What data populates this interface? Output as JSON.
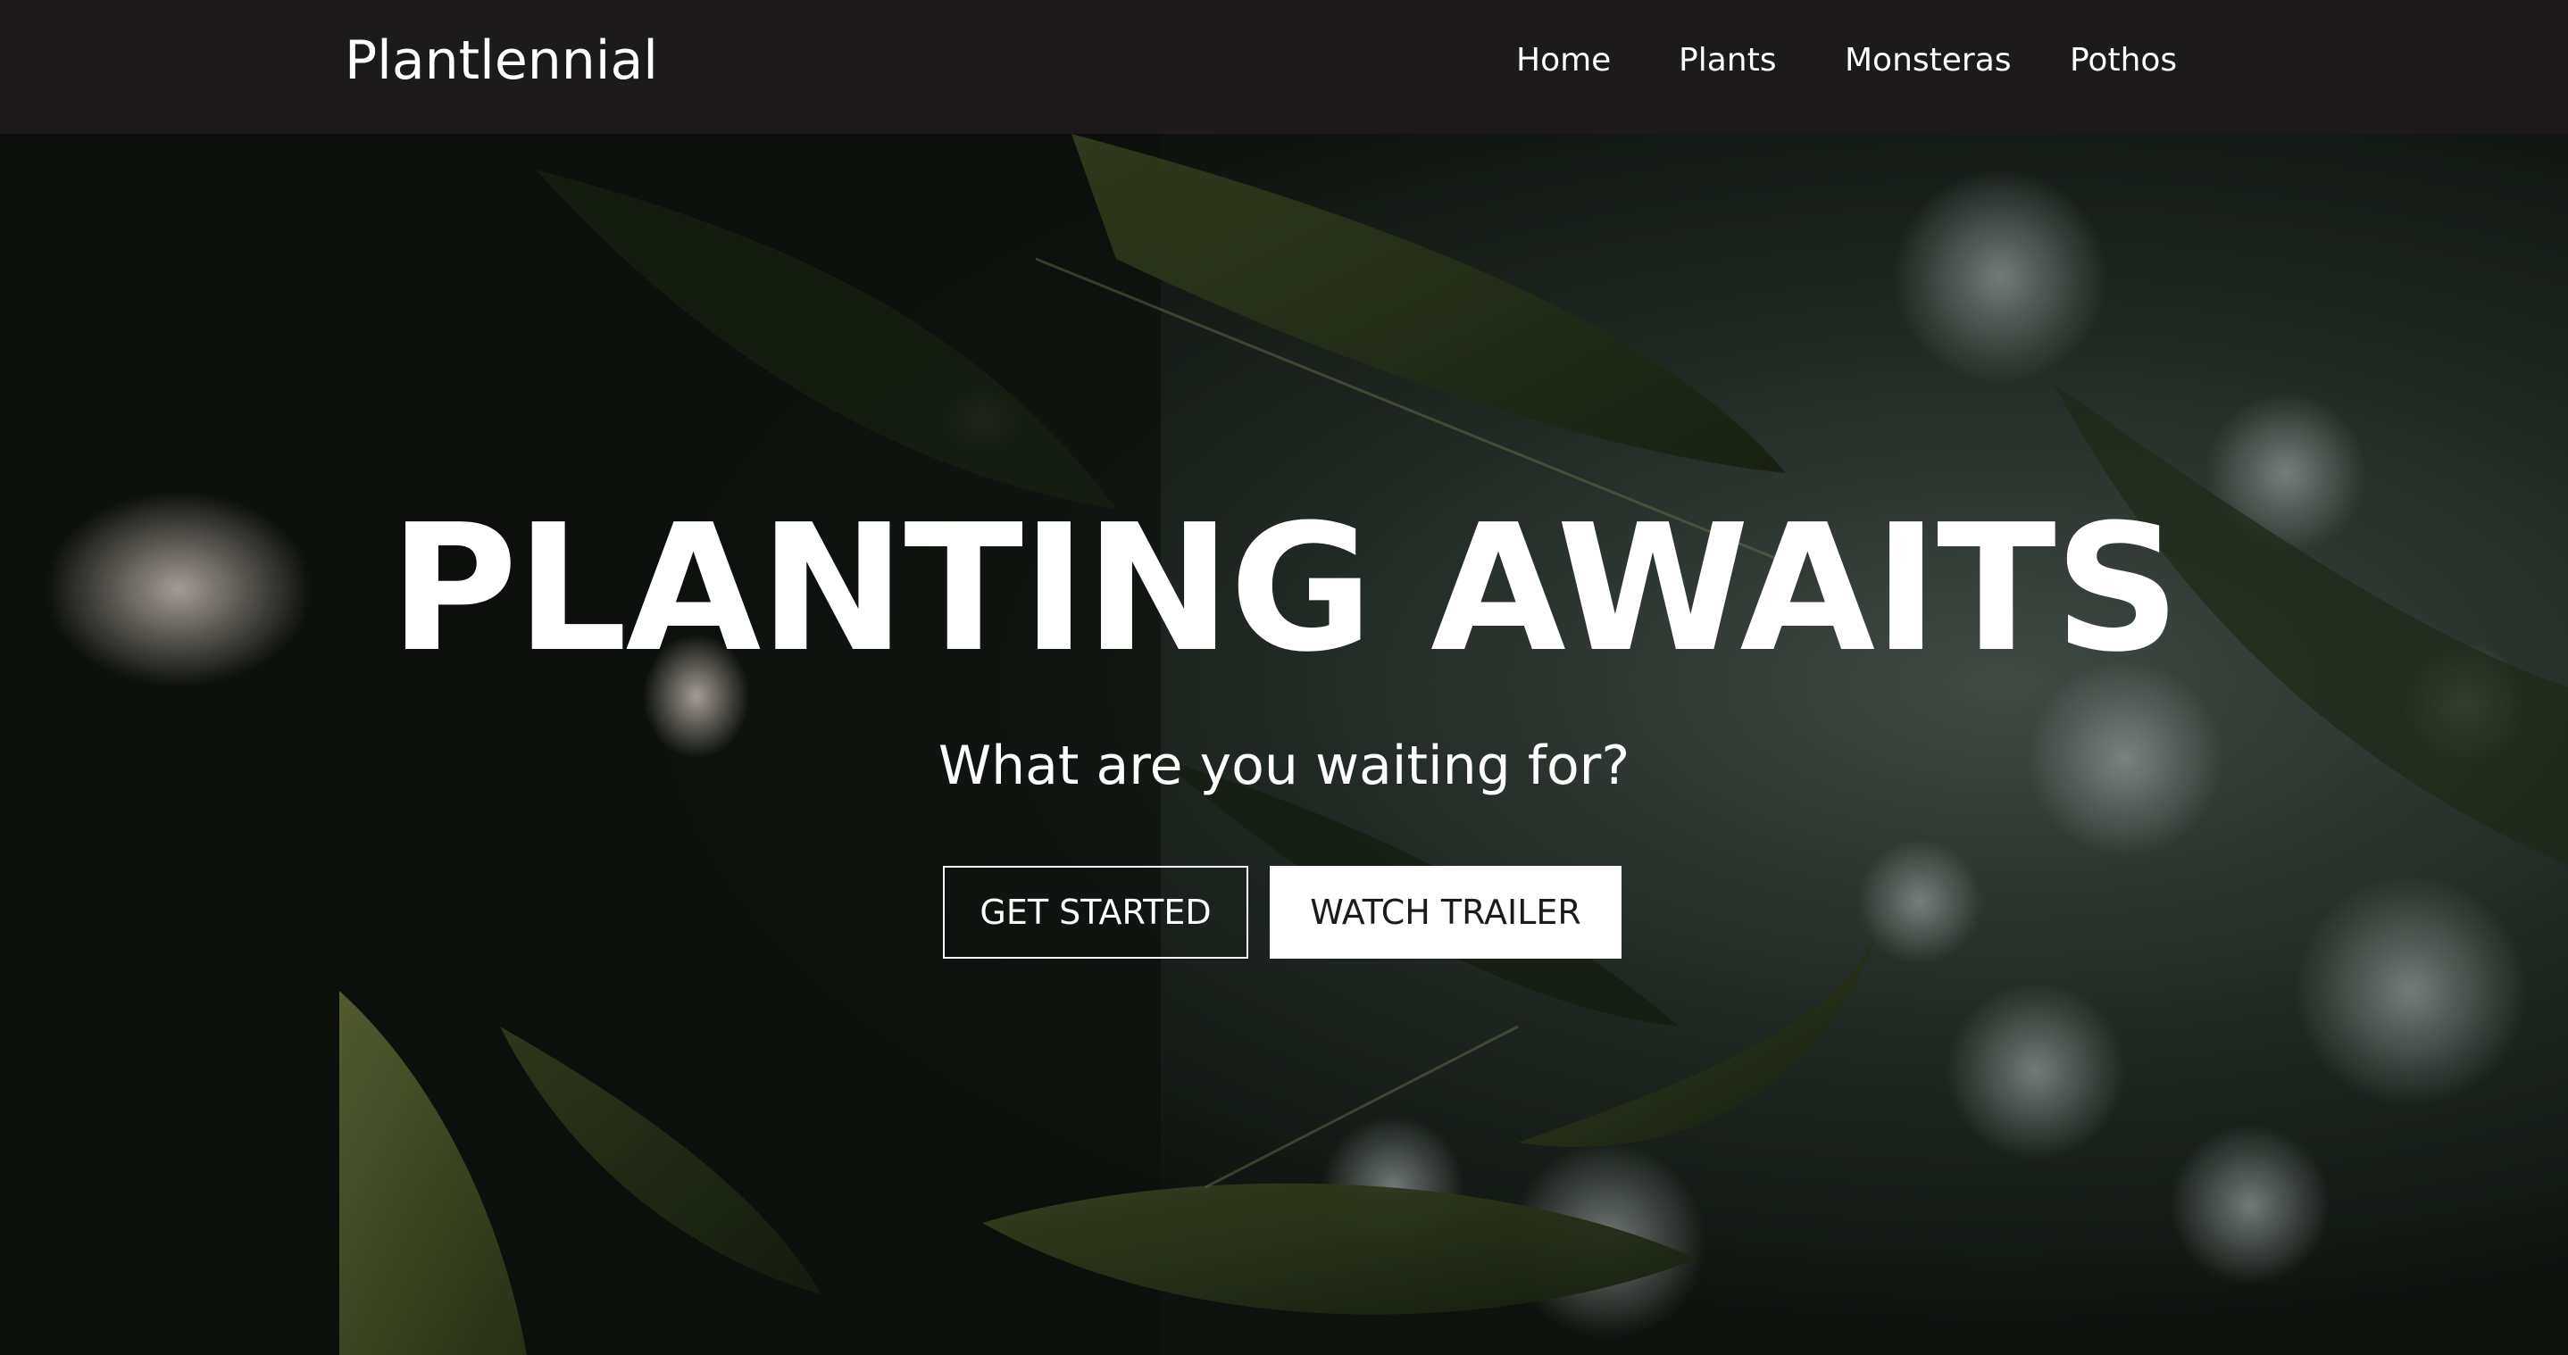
{
  "navbar": {
    "brand": "Plantlennial",
    "links": [
      {
        "label": "Home"
      },
      {
        "label": "Plants"
      },
      {
        "label": "Monsteras"
      },
      {
        "label": "Pothos"
      }
    ]
  },
  "hero": {
    "title": "PLANTING AWAITS",
    "subtitle": "What are you waiting for?",
    "primary_button": "GET STARTED",
    "secondary_button": "WATCH TRAILER"
  },
  "colors": {
    "navbar_background": "#1c1a1b",
    "text": "#ffffff",
    "button_text_dark": "#1c1a1b",
    "foliage_dark": "#1e2a1c",
    "foliage_light": "#6b7a3a"
  }
}
